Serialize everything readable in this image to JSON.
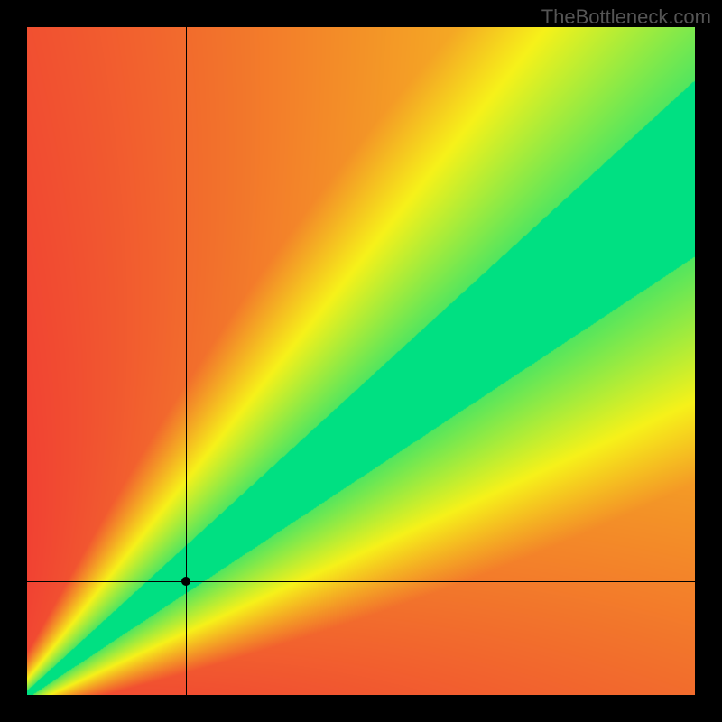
{
  "watermark": "TheBottleneck.com",
  "chart_data": {
    "type": "heatmap",
    "title": "",
    "xlabel": "",
    "ylabel": "",
    "xlim": [
      0,
      1
    ],
    "ylim": [
      0,
      1
    ],
    "grid": false,
    "legend": false,
    "colorscale_note": "red = worst match, yellow = moderate, green = optimal balance band",
    "optimal_band": {
      "slope": 0.78,
      "intercept": 0.0,
      "half_width": 0.055,
      "falloff_sharpness": 6.0
    },
    "crosshair": {
      "x": 0.238,
      "y": 0.17
    },
    "marker": {
      "x": 0.238,
      "y": 0.17
    },
    "colors": {
      "worst": "#f02038",
      "mid": "#f7f21a",
      "best": "#00e082"
    }
  }
}
